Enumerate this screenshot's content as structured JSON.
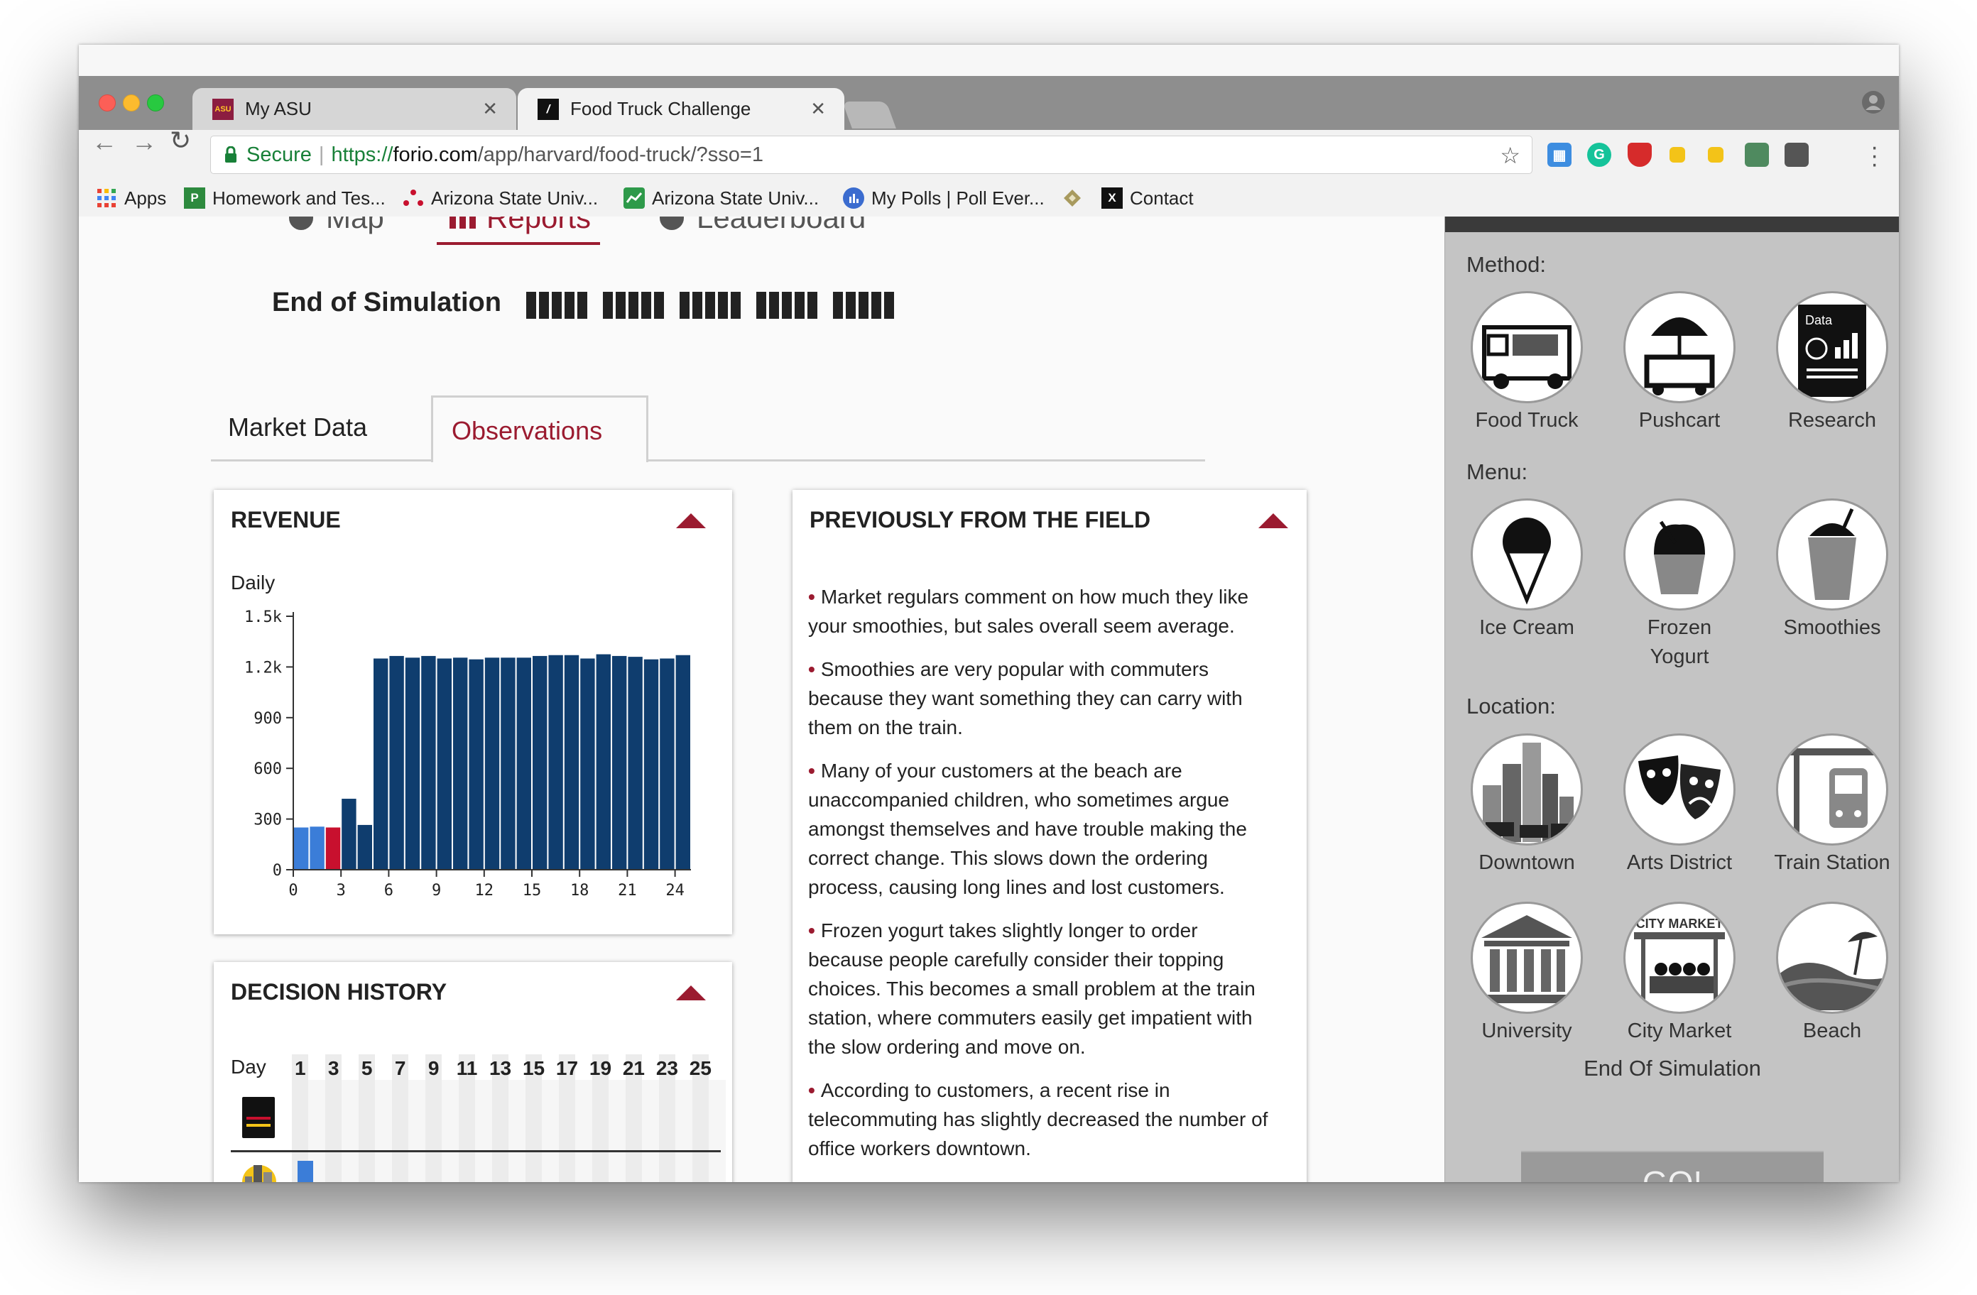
{
  "browser": {
    "tabs": [
      {
        "title": "My ASU",
        "favicon_text": "ASU"
      },
      {
        "title": "Food Truck Challenge",
        "favicon_text": "/"
      }
    ],
    "omnibox": {
      "secure_label": "Secure",
      "url_scheme": "https://",
      "url_host": "forio.com",
      "url_path": "/app/harvard/food-truck/?sso=1"
    },
    "bookmarks": [
      {
        "label": "Apps",
        "icon": "apps-grid-icon"
      },
      {
        "label": "Homework and Tes...",
        "icon": "p-icon",
        "icon_text": "P"
      },
      {
        "label": "Arizona State Univ...",
        "icon": "dots-icon"
      },
      {
        "label": "Arizona State Univ...",
        "icon": "chart-icon"
      },
      {
        "label": "My Polls | Poll Ever...",
        "icon": "poll-icon"
      },
      {
        "label": "",
        "icon": "diamond-icon"
      },
      {
        "label": "Contact",
        "icon": "x-icon",
        "icon_text": "X"
      }
    ]
  },
  "app": {
    "nav": {
      "map": "Map",
      "reports": "Reports",
      "leaderboard": "Leaderboard"
    },
    "end_title": "End of Simulation",
    "subtabs": {
      "market": "Market Data",
      "observations": "Observations"
    },
    "revenue": {
      "title": "REVENUE",
      "period": "Daily"
    },
    "decision": {
      "title": "DECISION HISTORY",
      "day_label": "Day",
      "days": [
        "1",
        "3",
        "5",
        "7",
        "9",
        "11",
        "13",
        "15",
        "17",
        "19",
        "21",
        "23",
        "25"
      ]
    },
    "field": {
      "title": "PREVIOUSLY FROM THE FIELD",
      "items": [
        "Market regulars comment on how much they like your smoothies, but sales overall seem average.",
        "Smoothies are very popular with commuters because they want something they can carry with them on the train.",
        "Many of your customers at the beach are unaccompanied children, who sometimes argue amongst themselves and have trouble making the correct change. This slows down the ordering process, causing long lines and lost customers.",
        "Frozen yogurt takes slightly longer to order because people carefully consider their topping choices. This becomes a small problem at the train station, where commuters easily get impatient with the slow ordering and move on.",
        "According to customers, a recent rise in telecommuting has slightly decreased the number of office workers downtown."
      ]
    },
    "sidebar": {
      "method_label": "Method:",
      "methods": [
        {
          "label": "Food Truck",
          "icon": "food-truck-icon"
        },
        {
          "label": "Pushcart",
          "icon": "pushcart-icon"
        },
        {
          "label": "Research",
          "icon": "research-icon",
          "icon_text": "Data"
        }
      ],
      "menu_label": "Menu:",
      "menus": [
        {
          "label": "Ice Cream",
          "icon": "ice-cream-icon"
        },
        {
          "label": "Frozen Yogurt",
          "icon": "frozen-yogurt-icon"
        },
        {
          "label": "Smoothies",
          "icon": "smoothie-icon"
        }
      ],
      "location_label": "Location:",
      "locations": [
        {
          "label": "Downtown",
          "icon": "downtown-icon"
        },
        {
          "label": "Arts District",
          "icon": "theater-masks-icon"
        },
        {
          "label": "Train Station",
          "icon": "train-icon"
        },
        {
          "label": "University",
          "icon": "university-icon"
        },
        {
          "label": "City Market",
          "icon": "city-market-icon",
          "icon_text": "CITY MARKET"
        },
        {
          "label": "Beach",
          "icon": "beach-icon"
        }
      ],
      "end_text": "End Of Simulation",
      "go_label": "GO!"
    }
  },
  "colors": {
    "accent": "#9b1b30",
    "bar_main": "#0f3d6e",
    "bar_light": "#3b7dd8",
    "bar_highlight": "#c8102e",
    "secure": "#188038"
  },
  "chart_data": {
    "type": "bar",
    "title": "REVENUE",
    "subtitle": "Daily",
    "x": [
      1,
      2,
      3,
      4,
      5,
      6,
      7,
      8,
      9,
      10,
      11,
      12,
      13,
      14,
      15,
      16,
      17,
      18,
      19,
      20,
      21,
      22,
      23,
      24,
      25
    ],
    "values": [
      250,
      255,
      250,
      420,
      265,
      1250,
      1265,
      1255,
      1265,
      1250,
      1255,
      1245,
      1255,
      1255,
      1255,
      1265,
      1270,
      1270,
      1250,
      1275,
      1265,
      1260,
      1245,
      1250,
      1270
    ],
    "bar_colors": [
      "light",
      "light",
      "highlight",
      "main",
      "main",
      "main",
      "main",
      "main",
      "main",
      "main",
      "main",
      "main",
      "main",
      "main",
      "main",
      "main",
      "main",
      "main",
      "main",
      "main",
      "main",
      "main",
      "main",
      "main",
      "main"
    ],
    "y_ticks": [
      "0",
      "300",
      "600",
      "900",
      "1.2k",
      "1.5k"
    ],
    "x_ticks": [
      "0",
      "3",
      "6",
      "9",
      "12",
      "15",
      "18",
      "21",
      "24"
    ],
    "ylim": [
      0,
      1500
    ],
    "xlim": [
      0,
      25
    ],
    "grid": false,
    "legend": "none"
  }
}
